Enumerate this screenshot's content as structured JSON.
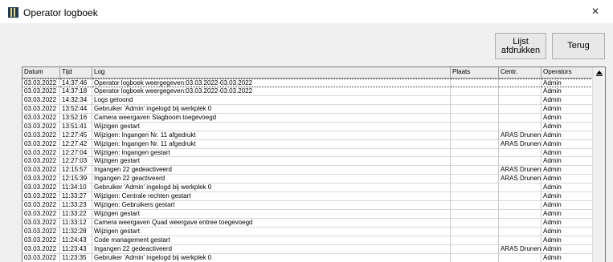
{
  "window": {
    "title": "Operator logboek",
    "close_glyph": "×"
  },
  "toolbar": {
    "print_label_line1": "Lijst",
    "print_label_line2": "afdrukken",
    "back_label": "Terug"
  },
  "table": {
    "columns": [
      "Datum",
      "Tijd",
      "Log",
      "Plaats",
      "Centr.",
      "Operators"
    ],
    "rows": [
      [
        "03.03.2022",
        "14:37:46",
        "Operator logboek weergegeven:03.03.2022-03.03.2022",
        "",
        "",
        "Admin"
      ],
      [
        "03.03.2022",
        "14:37:18",
        "Operator logboek weergegeven:03.03.2022-03.03.2022",
        "",
        "",
        "Admin"
      ],
      [
        "03.03.2022",
        "14:32:34",
        "Logs getoond",
        "",
        "",
        "Admin"
      ],
      [
        "03.03.2022",
        "13:52:44",
        "Gebruiker 'Admin' ingelogd bij werkplek 0",
        "",
        "",
        "Admin"
      ],
      [
        "03.03.2022",
        "13:52:16",
        "Camera weergaven Slagboom toegevoegd",
        "",
        "",
        "Admin"
      ],
      [
        "03.03.2022",
        "13:51:41",
        "Wijzigen gestart",
        "",
        "",
        "Admin"
      ],
      [
        "03.03.2022",
        "12:27:45",
        "Wijzigen: Ingangen Nr. 11 afgedrukt",
        "",
        "ARAS Drunen",
        "Admin"
      ],
      [
        "03.03.2022",
        "12:27:42",
        "Wijzigen: Ingangen Nr. 11 afgedrukt",
        "",
        "ARAS Drunen",
        "Admin"
      ],
      [
        "03.03.2022",
        "12:27:04",
        "Wijzigen: Ingangen gestart",
        "",
        "",
        "Admin"
      ],
      [
        "03.03.2022",
        "12:27:03",
        "Wijzigen gestart",
        "",
        "",
        "Admin"
      ],
      [
        "03.03.2022",
        "12:15:57",
        "Ingangen 22 gedeactiveerd",
        "",
        "ARAS Drunen",
        "Admin"
      ],
      [
        "03.03.2022",
        "12:15:39",
        "Ingangen 22 geactiveerd",
        "",
        "ARAS Drunen",
        "Admin"
      ],
      [
        "03.03.2022",
        "11:34:10",
        "Gebruiker 'Admin' ingelogd bij werkplek 0",
        "",
        "",
        "Admin"
      ],
      [
        "03.03.2022",
        "11:33:27",
        "Wijzigen: Centrale rechten gestart",
        "",
        "",
        "Admin"
      ],
      [
        "03.03.2022",
        "11:33:23",
        "Wijzigen: Gebruikers gestart",
        "",
        "",
        "Admin"
      ],
      [
        "03.03.2022",
        "11:33:22",
        "Wijzigen gestart",
        "",
        "",
        "Admin"
      ],
      [
        "03.03.2022",
        "11:33:12",
        "Camera weergaven Quad weergave entree toegevoegd",
        "",
        "",
        "Admin"
      ],
      [
        "03.03.2022",
        "11:32:28",
        "Wijzigen gestart",
        "",
        "",
        "Admin"
      ],
      [
        "03.03.2022",
        "11:24:43",
        "Code management gestart",
        "",
        "",
        "Admin"
      ],
      [
        "03.03.2022",
        "11:23:43",
        "Ingangen 22 gedeactiveerd",
        "",
        "ARAS Drunen",
        "Admin"
      ],
      [
        "03.03.2022",
        "11:23:35",
        "Gebruiker 'Admin' ingelogd bij werkplek 0",
        "",
        "",
        "Admin"
      ]
    ]
  },
  "icons": {
    "app": "operator-logbook-app-icon",
    "scroll_up": "arrow-up-icon"
  }
}
